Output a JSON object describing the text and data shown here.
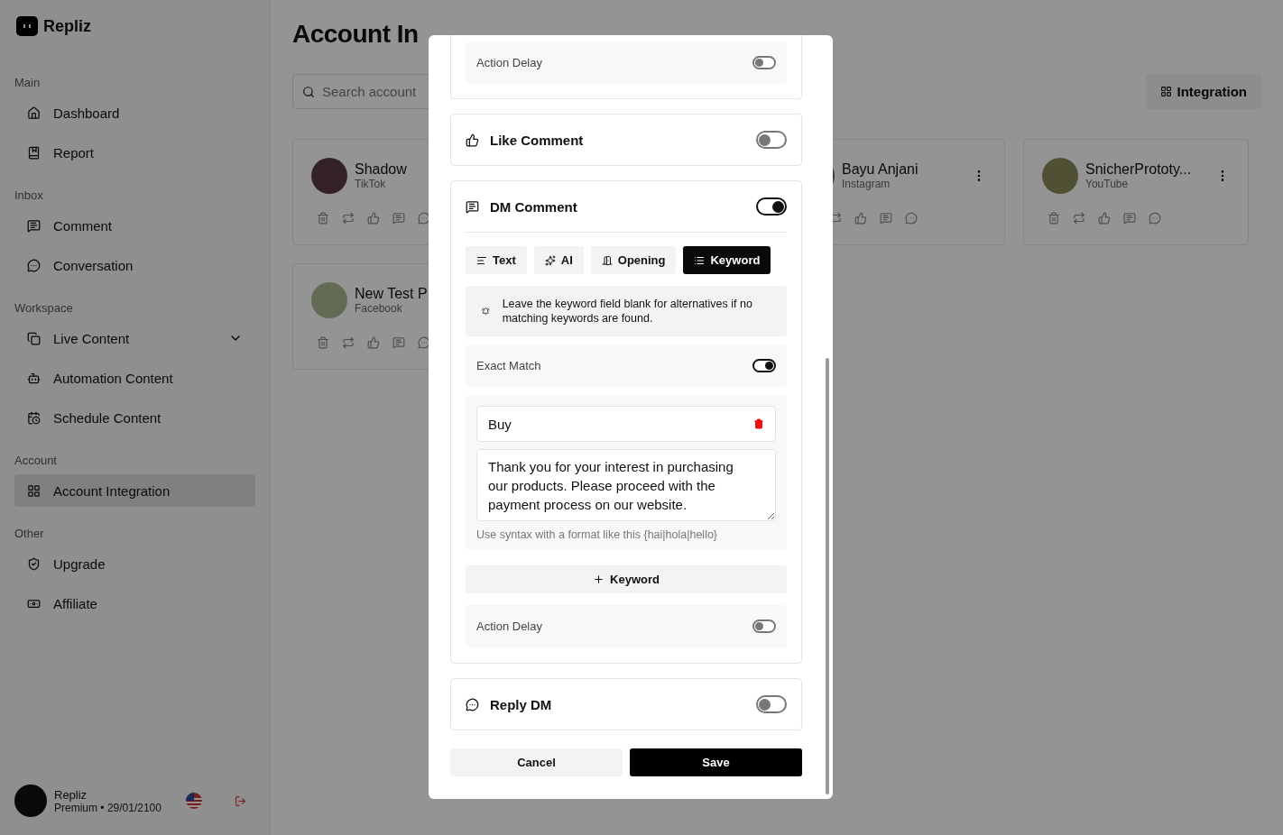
{
  "brand": {
    "name": "Repliz"
  },
  "sidebar": {
    "sections": [
      {
        "title": "Main",
        "items": [
          {
            "label": "Dashboard",
            "kind": "link",
            "selected": false
          },
          {
            "label": "Report",
            "kind": "link",
            "selected": false
          }
        ]
      },
      {
        "title": "Inbox",
        "items": [
          {
            "label": "Comment",
            "kind": "link",
            "selected": false
          },
          {
            "label": "Conversation",
            "kind": "link",
            "selected": false
          }
        ]
      },
      {
        "title": "Workspace",
        "items": [
          {
            "label": "Live Content",
            "kind": "group",
            "selected": false
          },
          {
            "label": "Automation Content",
            "kind": "link",
            "selected": false
          },
          {
            "label": "Schedule Content",
            "kind": "link",
            "selected": false
          }
        ]
      },
      {
        "title": "Account",
        "items": [
          {
            "label": "Account Integration",
            "kind": "link",
            "selected": true
          }
        ]
      },
      {
        "title": "Other",
        "items": [
          {
            "label": "Upgrade",
            "kind": "link",
            "selected": false
          },
          {
            "label": "Affiliate",
            "kind": "link",
            "selected": false
          }
        ]
      }
    ]
  },
  "user": {
    "name": "Repliz",
    "plan": "Premium • 29/01/2100"
  },
  "page": {
    "title": "Account In",
    "search": {
      "placeholder": "Search account"
    },
    "integration_button": "Integration"
  },
  "accounts": [
    {
      "name": "Shadow",
      "platform": "TikTok"
    },
    {
      "name": "Bayu Anjani",
      "platform": "Instagram"
    },
    {
      "name": "SnicherPrototy...",
      "platform": "YouTube"
    },
    {
      "name": "New Test P",
      "platform": "Facebook"
    }
  ],
  "modal": {
    "sections": [
      {
        "kind": "partial",
        "label": "Action Delay",
        "on": false
      },
      {
        "kind": "toggle",
        "title": "Like Comment",
        "on": false
      },
      {
        "kind": "expanded",
        "title": "DM Comment",
        "on": true,
        "tabs": [
          {
            "label": "Text",
            "selected": false
          },
          {
            "label": "AI",
            "selected": false
          },
          {
            "label": "Opening",
            "selected": false
          },
          {
            "label": "Keyword",
            "selected": true
          }
        ],
        "note": "Leave the keyword field blank for alternatives if no matching keywords are found.",
        "exact_match": {
          "label": "Exact Match",
          "on": true
        },
        "keywords": [
          {
            "keyword": "Buy",
            "reply": "Thank you for your interest in purchasing our products. Please proceed with the payment process on our website.",
            "hint": "Use syntax with a format like this {hai|hola|hello}"
          }
        ],
        "add_button": "Keyword",
        "action_delay": {
          "label": "Action Delay",
          "on": false
        }
      },
      {
        "kind": "toggle",
        "title": "Reply DM",
        "on": false
      }
    ],
    "buttons": [
      {
        "label": "Cancel",
        "kind": "secondary"
      },
      {
        "label": "Save",
        "kind": "primary"
      }
    ]
  }
}
